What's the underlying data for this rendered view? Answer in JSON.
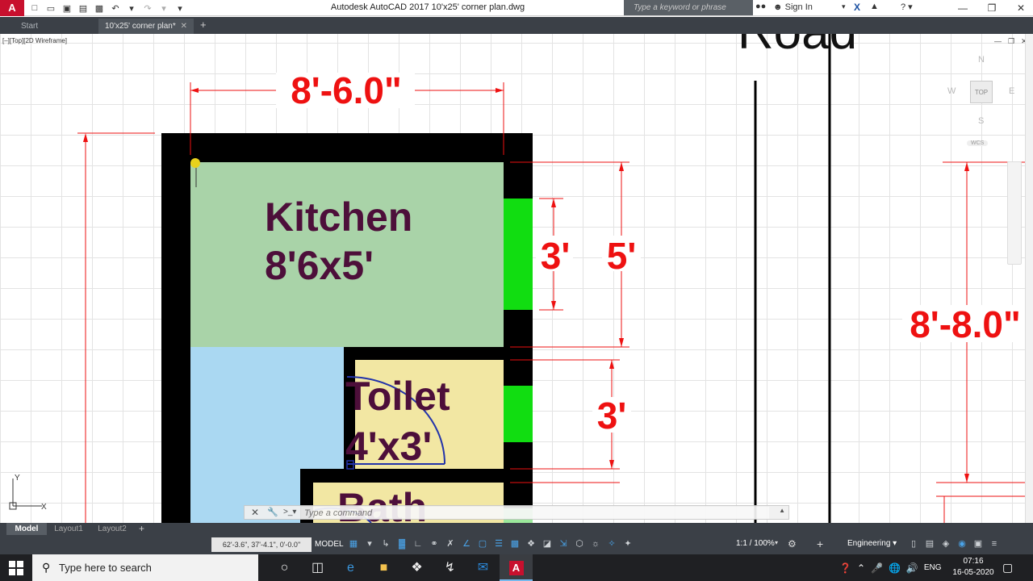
{
  "app": {
    "logo": "A",
    "title": "Autodesk AutoCAD 2017    10'x25' corner plan.dwg",
    "search_placeholder": "Type a keyword or phrase",
    "sign_in": "Sign In"
  },
  "tabs": {
    "start": "Start",
    "file": "10'x25' corner plan*"
  },
  "canvas": {
    "viewport_label": "[–][Top][2D Wireframe]",
    "road_label": "Road",
    "viewcube": {
      "north": "N",
      "south": "S",
      "east": "E",
      "west": "W",
      "top": "TOP",
      "wcs": "WCS"
    },
    "ucs": {
      "x": "X",
      "y": "Y"
    }
  },
  "plan": {
    "dim_top": "8'-6.0\"",
    "dim_right": "8'-8.0\"",
    "dim_window1": "3'",
    "dim_kitchen_h": "5'",
    "dim_toilet_h": "3'",
    "kitchen": {
      "name": "Kitchen",
      "size": "8'6x5'"
    },
    "toilet": {
      "name": "Toilet",
      "size": "4'x3'"
    },
    "bath": {
      "name": "Bath"
    },
    "colors": {
      "wall": "#000000",
      "kitchen": "#a9d3a8",
      "blue_room": "#aad8f2",
      "toilet": "#f2e7a3",
      "window": "#11dd11",
      "dimension": "#ee1111",
      "room_text": "#4d0f3a",
      "door_arc": "#2233aa"
    }
  },
  "command_line": {
    "placeholder": "Type a command"
  },
  "layout_tabs": [
    "Model",
    "Layout1",
    "Layout2"
  ],
  "status": {
    "coords": "62'-3.6\", 37'-4.1\", 0'-0.0\"",
    "model": "MODEL",
    "scale": "1:1 / 100%",
    "workspace": "Engineering"
  },
  "taskbar": {
    "search_text": "Type here to search",
    "lang": "ENG",
    "time": "07:16",
    "date": "16-05-2020"
  }
}
